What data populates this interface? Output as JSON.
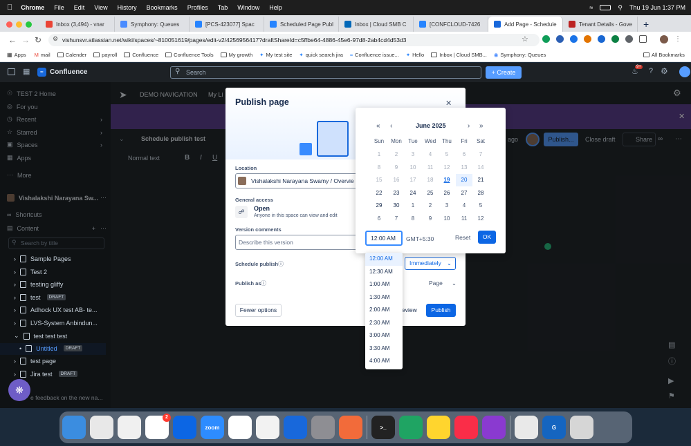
{
  "mac": {
    "apple": "",
    "app": "Chrome",
    "menus": [
      "File",
      "Edit",
      "View",
      "History",
      "Bookmarks",
      "Profiles",
      "Tab",
      "Window",
      "Help"
    ],
    "clock": "Thu 19 Jun  1:37 PM"
  },
  "tabs": [
    {
      "title": "Inbox (3,494) - vnar",
      "color": "#ea4335"
    },
    {
      "title": "Symphony: Queues",
      "color": "#4a8cff"
    },
    {
      "title": "[PCS-423077] Spac",
      "color": "#2684ff"
    },
    {
      "title": "Scheduled Page Publ",
      "color": "#2684ff"
    },
    {
      "title": "Inbox | Cloud SMB C",
      "color": "#0067b8"
    },
    {
      "title": "[CONFCLOUD-7426",
      "color": "#2684ff"
    },
    {
      "title": "Add Page - Schedule",
      "color": "#1868db",
      "active": true
    },
    {
      "title": "Tenant Details - Gove",
      "color": "#b22"
    }
  ],
  "url": "vishunsvr.atlassian.net/wiki/spaces/~810051619/pages/edit-v2/4256956417?draftShareId=c5ffbe64-4886-45e6-97d8-2ab4cd4d53d3",
  "bookmarks": [
    "Apps",
    "mail",
    "Calender",
    "payroll",
    "Confluence",
    "Confluence Tools",
    "My growth",
    "My test site",
    "quick search jira",
    "Confluence issue...",
    "Hello",
    "Inbox | Cloud SMB...",
    "Symphony: Queues",
    "All Bookmarks"
  ],
  "confluence": {
    "product": "Confluence",
    "search_placeholder": "Search",
    "create_label": "+ Create",
    "notif_count": "9+"
  },
  "sidebar": {
    "nav": [
      "TEST 2 Home",
      "For you",
      "Recent",
      "Starred",
      "Spaces",
      "Apps",
      "More"
    ],
    "space_name": "Vishalakshi Narayana Sw...",
    "shortcuts": "Shortcuts",
    "content": "Content",
    "filter_placeholder": "Search by title",
    "tree": [
      {
        "label": "Sample Pages",
        "draft": ""
      },
      {
        "label": "Test 2",
        "draft": ""
      },
      {
        "label": "testing gliffy",
        "draft": ""
      },
      {
        "label": "test",
        "draft": "DRAFT"
      },
      {
        "label": "Adhock UX test AB- te...",
        "draft": ""
      },
      {
        "label": "LVS-System Anbindun...",
        "draft": ""
      },
      {
        "label": "test test test",
        "draft": ""
      },
      {
        "label": "Untitled",
        "draft": "DRAFT"
      },
      {
        "label": "test page",
        "draft": ""
      },
      {
        "label": "Jira test",
        "draft": "DRAFT"
      }
    ],
    "feedback": "e feedback on the new na..."
  },
  "editor": {
    "space_nav": "DEMO NAVIGATION",
    "my_link": "My Li",
    "page_title": "Schedule publish test",
    "format": "Normal text",
    "ago": "ago",
    "publish_btn": "Publish...",
    "close_draft": "Close draft",
    "share": "Share"
  },
  "modal": {
    "title": "Publish page",
    "location_label": "Location",
    "location_value": "Vishalakshi Narayana Swamy / Overvie",
    "access_label": "General access",
    "access_value": "Open",
    "access_desc": "Anyone in this space can view and edit",
    "version_label": "Version comments",
    "version_placeholder": "Describe this version",
    "schedule_label": "Schedule publish",
    "schedule_value": "Immediately",
    "publish_as_label": "Publish as",
    "publish_as_value": "Page",
    "fewer_options": "Fewer options",
    "preview": "eview",
    "publish": "Publish"
  },
  "calendar": {
    "month": "June 2025",
    "weekdays": [
      "Sun",
      "Mon",
      "Tue",
      "Wed",
      "Thu",
      "Fri",
      "Sat"
    ],
    "weeks": [
      [
        "1",
        "2",
        "3",
        "4",
        "5",
        "6",
        "7"
      ],
      [
        "8",
        "9",
        "10",
        "11",
        "12",
        "13",
        "14"
      ],
      [
        "15",
        "16",
        "17",
        "18",
        "19",
        "20",
        "21"
      ],
      [
        "22",
        "23",
        "24",
        "25",
        "26",
        "27",
        "28"
      ],
      [
        "29",
        "30",
        "1",
        "2",
        "3",
        "4",
        "5"
      ],
      [
        "6",
        "7",
        "8",
        "9",
        "10",
        "11",
        "12"
      ]
    ],
    "today": "19",
    "selected": "20",
    "time_value": "12:00 AM",
    "timezone": "GMT+5:30",
    "reset": "Reset",
    "ok": "OK"
  },
  "time_options": [
    "12:00 AM",
    "12:30 AM",
    "1:00 AM",
    "1:30 AM",
    "2:00 AM",
    "2:30 AM",
    "3:00 AM",
    "3:30 AM",
    "4:00 AM"
  ],
  "dock": [
    {
      "name": "Finder",
      "color": "#3b8de0",
      "label": ""
    },
    {
      "name": "Launchpad",
      "color": "#e8e8e8",
      "label": ""
    },
    {
      "name": "Freeform",
      "color": "#f0f0f0",
      "label": ""
    },
    {
      "name": "Slack",
      "color": "#ffffff",
      "label": "",
      "badge": "2"
    },
    {
      "name": "Trello",
      "color": "#0c66e4",
      "label": ""
    },
    {
      "name": "Zoom",
      "color": "#2d8cff",
      "label": "zoom"
    },
    {
      "name": "Chrome",
      "color": "#ffffff",
      "label": ""
    },
    {
      "name": "Scrapbook",
      "color": "#f2f2f2",
      "label": ""
    },
    {
      "name": "Atlassian",
      "color": "#1868db",
      "label": ""
    },
    {
      "name": "Settings",
      "color": "#8e8e93",
      "label": ""
    },
    {
      "name": "Pen",
      "color": "#f26b3a",
      "label": ""
    },
    {
      "name": "Terminal",
      "color": "#222",
      "label": ">_"
    },
    {
      "name": "Edge",
      "color": "#1fa463",
      "label": ""
    },
    {
      "name": "Notes",
      "color": "#ffd52e",
      "label": ""
    },
    {
      "name": "Music",
      "color": "#fa2d48",
      "label": ""
    },
    {
      "name": "Vidmore",
      "color": "#8a3ad0",
      "label": ""
    },
    {
      "name": "Preview",
      "color": "#e9e9e9",
      "label": ""
    },
    {
      "name": "Gadget",
      "color": "#1565c0",
      "label": "G"
    },
    {
      "name": "Trash",
      "color": "#d6d6d6",
      "label": ""
    }
  ]
}
